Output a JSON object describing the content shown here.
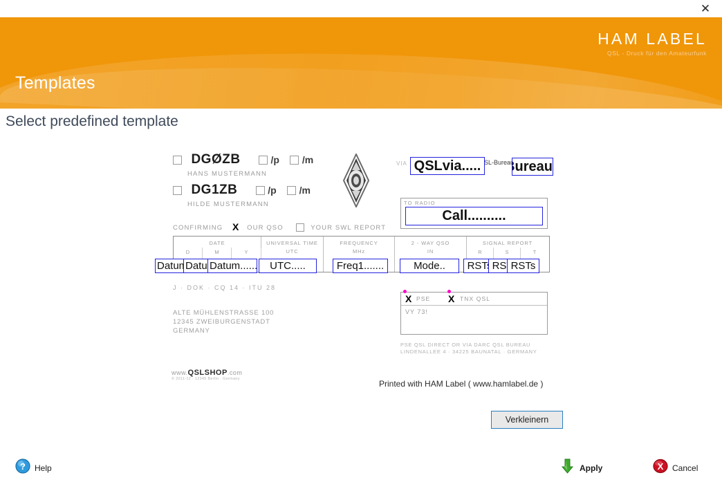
{
  "window": {
    "close_label": "✕",
    "accent_color": "#f09609"
  },
  "brand": {
    "name": "HAM LABEL",
    "tagline": "QSL - Druck für den Amateurfunk"
  },
  "header": {
    "title": "Templates"
  },
  "page": {
    "subtitle": "Select predefined template"
  },
  "card": {
    "operators": [
      {
        "callsign": "DGØZB",
        "name": "HANS MUSTERMANN",
        "p_label": "/p",
        "m_label": "/m"
      },
      {
        "callsign": "DG1ZB",
        "name": "HILDE MUSTERMANN",
        "p_label": "/p",
        "m_label": "/m"
      }
    ],
    "via_label": "VIA",
    "qsl_bureau_label": "QSL-Bureau:",
    "confirming": {
      "prefix": "CONFIRMING",
      "x": "X",
      "our_qso": "OUR QSO",
      "swl": "YOUR SWL REPORT"
    },
    "to_radio_label": "TO RADIO",
    "table_headers": {
      "date": "DATE",
      "date_sub": [
        "D",
        "M",
        "Y"
      ],
      "utc": "UNIVERSAL TIME",
      "utc_sub": "UTC",
      "freq": "FREQUENCY",
      "freq_sub": "MHz",
      "mode": "2 - WAY QSO",
      "mode_sub": "IN",
      "signal": "SIGNAL REPORT",
      "signal_sub": [
        "R",
        "S",
        "T"
      ]
    },
    "dok_row": "J  ·  DOK  ·  CQ 14  ·  ITU 28",
    "address": [
      "ALTE MÜHLENSTRASSE 100",
      "12345 ZWEIBURGENSTADT",
      "GERMANY"
    ],
    "pse_row": {
      "x1": "X",
      "pse": "PSE",
      "x2": "X",
      "tnx": "TNX QSL"
    },
    "vy73": "VY 73!",
    "pse_footer": [
      "PSE QSL DIRECT OR VIA DARC QSL BUREAU",
      "LINDENALLEE 4 · 34225 BAUNATAL · GERMANY"
    ],
    "qslshop": {
      "www": "www.",
      "main": "QSLSHOP",
      "com": ".com",
      "sub": "© 2011-12  · 12345 Berlin · Germany"
    },
    "printed_with": "Printed with HAM Label ( www.hamlabel.de )"
  },
  "fields": [
    {
      "id": "qslvia",
      "value": "QSLvia....."
    },
    {
      "id": "bureau",
      "value": "__Bureau"
    },
    {
      "id": "call",
      "value": "Call.........."
    },
    {
      "id": "datum1",
      "value": "Datum......"
    },
    {
      "id": "datum2",
      "value": "Datum......"
    },
    {
      "id": "datum3",
      "value": "Datum......"
    },
    {
      "id": "utc",
      "value": "UTC....."
    },
    {
      "id": "freq",
      "value": "Freq1......."
    },
    {
      "id": "mode",
      "value": "Mode.."
    },
    {
      "id": "rst1",
      "value": "RSTs"
    },
    {
      "id": "rst2",
      "value": "RSTs"
    },
    {
      "id": "rst3",
      "value": "RSTs"
    }
  ],
  "buttons": {
    "verkleinern": "Verkleinern",
    "help": "Help",
    "apply": "Apply",
    "cancel": "Cancel"
  }
}
